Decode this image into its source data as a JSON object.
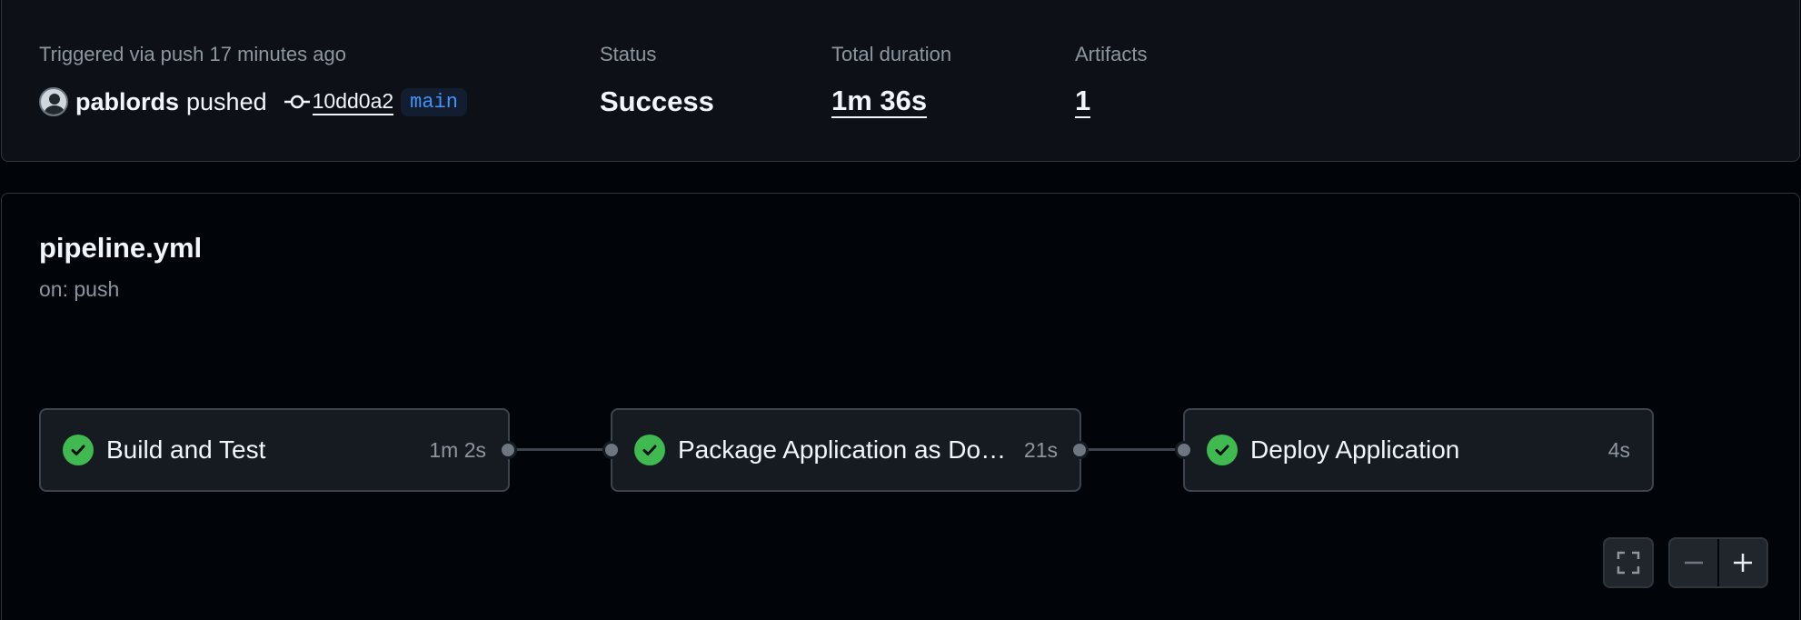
{
  "summary": {
    "trigger_label": "Triggered via push 17 minutes ago",
    "actor": "pablords",
    "action": "pushed",
    "commit_sha": "10dd0a2",
    "branch": "main",
    "status_label": "Status",
    "status_value": "Success",
    "duration_label": "Total duration",
    "duration_value": "1m 36s",
    "artifacts_label": "Artifacts",
    "artifacts_value": "1"
  },
  "workflow": {
    "file": "pipeline.yml",
    "trigger": "on: push",
    "jobs": [
      {
        "name": "Build and Test",
        "duration": "1m 2s",
        "status": "success"
      },
      {
        "name": "Package Application as Docker Image",
        "duration": "21s",
        "status": "success"
      },
      {
        "name": "Deploy Application",
        "duration": "4s",
        "status": "success"
      }
    ]
  },
  "controls": {
    "icons": [
      "fullscreen-icon",
      "zoom-out-icon",
      "zoom-in-icon"
    ]
  },
  "colors": {
    "success": "#3fb950",
    "branch": "#4493f8",
    "background": "#010409",
    "card": "#0d1117"
  }
}
